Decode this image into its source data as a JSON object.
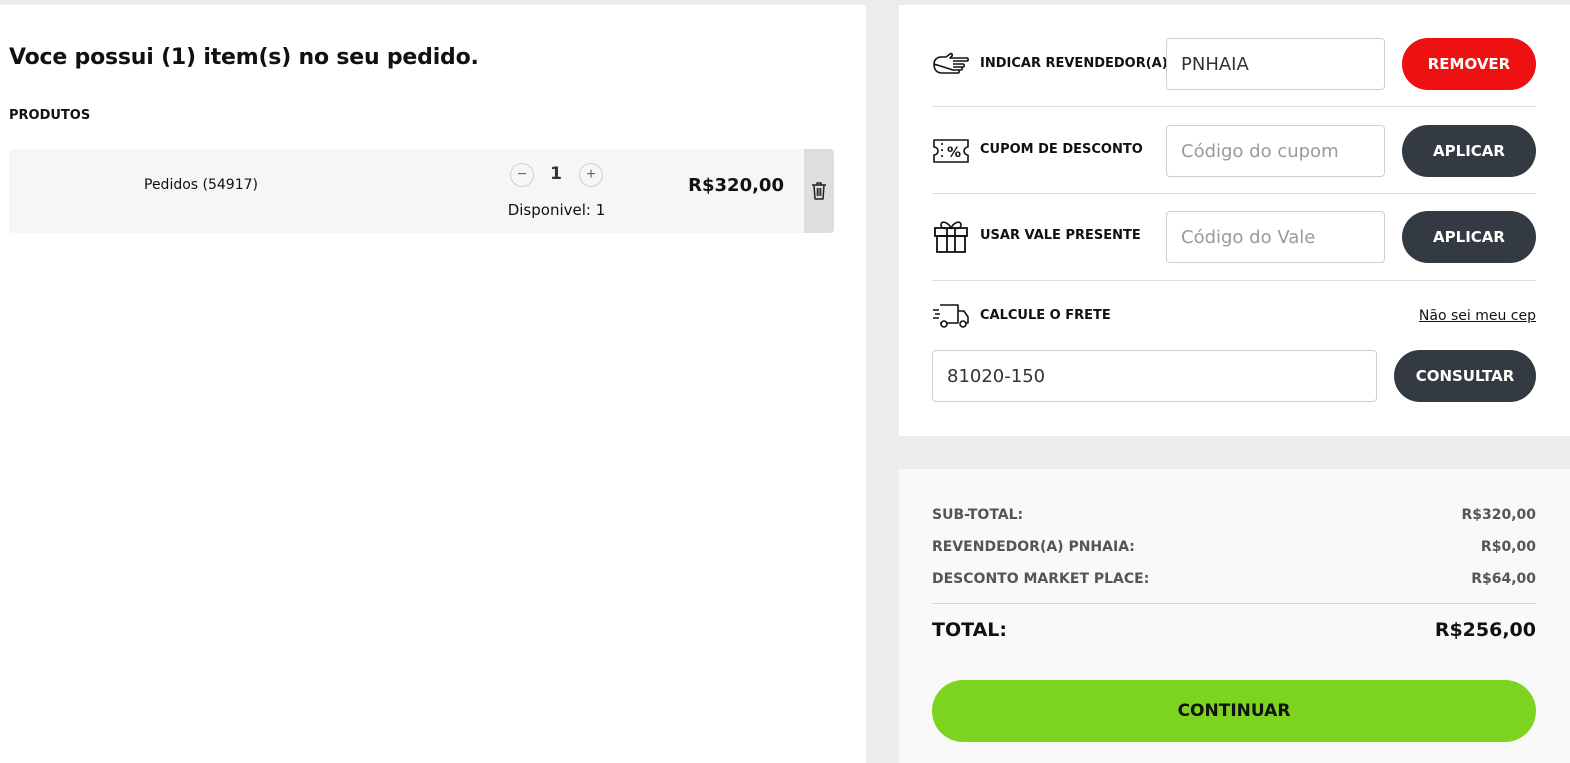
{
  "cart": {
    "title": "Voce possui (1) item(s) no seu pedido.",
    "products_label": "PRODUTOS",
    "items": [
      {
        "name": "Pedidos (54917)",
        "quantity": "1",
        "minus_icon": "−",
        "plus_icon": "+",
        "available": "Disponivel: 1",
        "price": "R$320,00"
      }
    ]
  },
  "reseller": {
    "icon": "pointing-hand-icon",
    "label": "INDICAR REVENDEDOR(A)",
    "value": "PNHAIA",
    "button": "REMOVER"
  },
  "coupon": {
    "icon": "discount-ticket-icon",
    "label": "CUPOM DE DESCONTO",
    "value": "",
    "placeholder": "Código do cupom",
    "button": "APLICAR"
  },
  "gift_card": {
    "icon": "gift-icon",
    "label": "USAR VALE PRESENTE",
    "value": "",
    "placeholder": "Código do Vale",
    "button": "APLICAR"
  },
  "shipping": {
    "icon": "delivery-truck-icon",
    "label": "CALCULE O FRETE",
    "link": "Não sei meu cep",
    "value": "81020-150",
    "button": "CONSULTAR"
  },
  "summary": {
    "subtotal_label": "SUB-TOTAL:",
    "subtotal_value": "R$320,00",
    "reseller_label": "REVENDEDOR(A) PNHAIA:",
    "reseller_value": "R$0,00",
    "discount_label": "DESCONTO MARKET PLACE:",
    "discount_value": "R$64,00",
    "total_label": "TOTAL:",
    "total_value": "R$256,00",
    "continue_button": "CONTINUAR"
  },
  "colors": {
    "remove_button": "#ee1111",
    "dark_button": "#343a42",
    "continue_button": "#7dd41e"
  }
}
